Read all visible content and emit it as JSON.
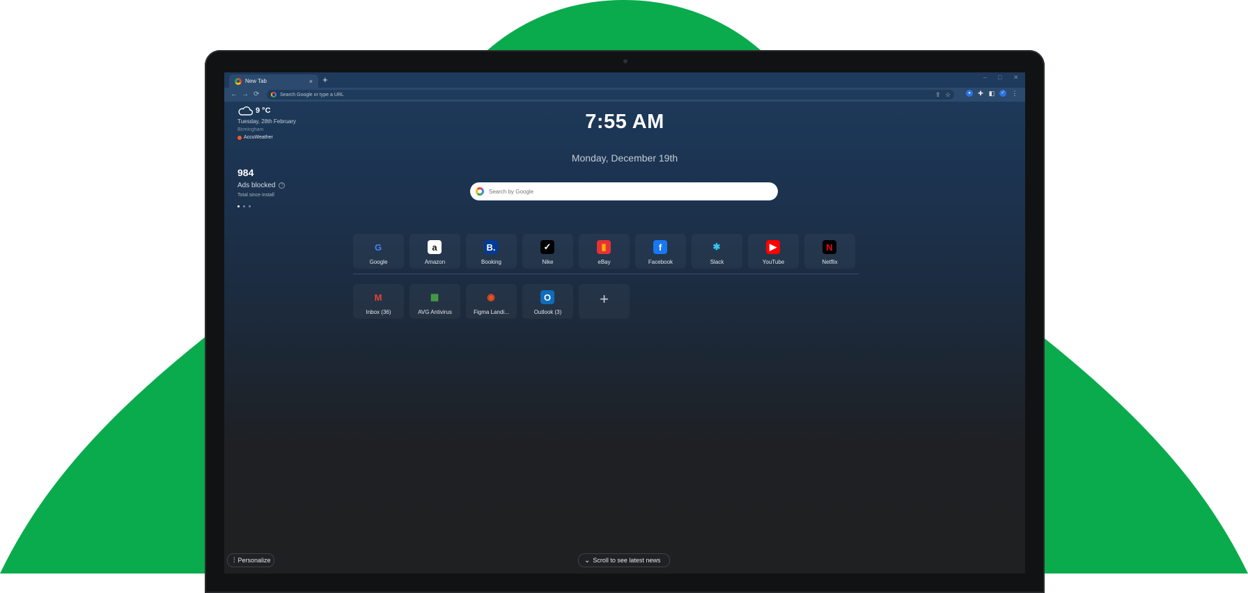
{
  "colors": {
    "brand_green": "#0aab4c",
    "screen_top": "#1d3b5c",
    "screen_bottom": "#1f2022"
  },
  "browser": {
    "tab_title": "New Tab",
    "tab_close": "×",
    "new_tab": "+",
    "window_controls": {
      "minimize": "–",
      "maximize": "□",
      "close": "✕"
    },
    "nav": {
      "back": "←",
      "forward": "→",
      "reload": "⟳"
    },
    "omnibox_placeholder": "Search Google or type a URL",
    "toolbar_icons": [
      "share-icon",
      "star-icon",
      "shield-icon",
      "puzzle-icon",
      "sidepanel-icon",
      "profile-icon",
      "menu-icon"
    ]
  },
  "weather": {
    "icon": "cloud-icon",
    "temperature": "9 °C",
    "date": "Tuesday, 28th February",
    "city": "Birmingham",
    "provider": "AccuWeather"
  },
  "ads": {
    "count": "984",
    "label": "Ads blocked",
    "help": "?",
    "sub": "Total since install"
  },
  "clock": {
    "time": "7:55 AM",
    "date": "Monday, December 19th"
  },
  "search": {
    "placeholder": "Search by Google"
  },
  "shortcuts_top": [
    {
      "label": "Google",
      "glyph": "G",
      "bg": "transparent",
      "fg": "#4285f4"
    },
    {
      "label": "Amazon",
      "glyph": "a",
      "bg": "#ffffff",
      "fg": "#111111"
    },
    {
      "label": "Booking",
      "glyph": "B.",
      "bg": "#003b95",
      "fg": "#ffffff"
    },
    {
      "label": "Nike",
      "glyph": "✓",
      "bg": "#000000",
      "fg": "#ffffff"
    },
    {
      "label": "eBay",
      "glyph": "▮",
      "bg": "#e53238",
      "fg": "#f5af02"
    },
    {
      "label": "Facebook",
      "glyph": "f",
      "bg": "#1877f2",
      "fg": "#ffffff"
    },
    {
      "label": "Slack",
      "glyph": "✱",
      "bg": "transparent",
      "fg": "#36c5f0"
    },
    {
      "label": "YouTube",
      "glyph": "▶",
      "bg": "#ff0000",
      "fg": "#ffffff"
    },
    {
      "label": "Netflix",
      "glyph": "N",
      "bg": "#000000",
      "fg": "#e50914"
    }
  ],
  "shortcuts_bottom": [
    {
      "label": "Inbox (36)",
      "glyph": "M",
      "bg": "transparent",
      "fg": "#ea4335"
    },
    {
      "label": "AVG Antivirus",
      "glyph": "▦",
      "bg": "transparent",
      "fg": "#46a445"
    },
    {
      "label": "Figma Landi...",
      "glyph": "◉",
      "bg": "transparent",
      "fg": "#f24e1e"
    },
    {
      "label": "Outlook (3)",
      "glyph": "O",
      "bg": "#0f6cbd",
      "fg": "#ffffff"
    }
  ],
  "add_shortcut": "+",
  "footer": {
    "personalize": "Personalize",
    "personalize_icon": "sliders-icon",
    "scroll_news": "Scroll to see latest news",
    "scroll_icon": "chevron-down-icon"
  }
}
